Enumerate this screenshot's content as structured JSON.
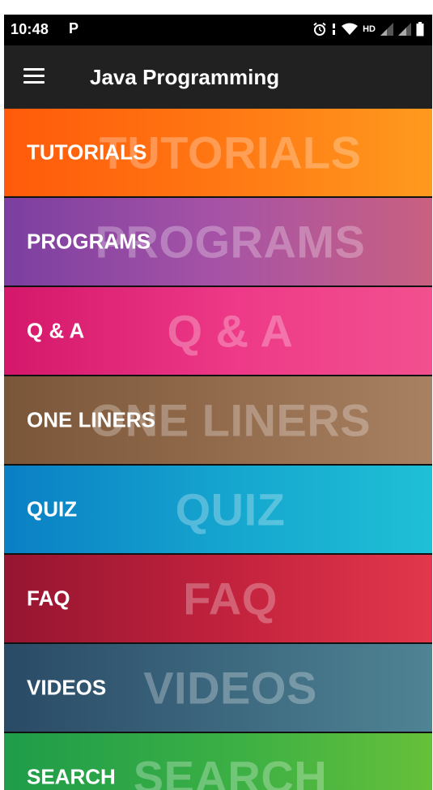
{
  "status_bar": {
    "time": "10:48",
    "notification": "P",
    "network_label": "HD"
  },
  "app_bar": {
    "title": "Java Programming",
    "menu_icon": "hamburger-menu-icon"
  },
  "menu": {
    "items": [
      {
        "label": "TUTORIALS",
        "watermark": "TUTORIALS",
        "color": "#ff7a14"
      },
      {
        "label": "PROGRAMS",
        "watermark": "PROGRAMS",
        "color": "#a653a6"
      },
      {
        "label": "Q & A",
        "watermark": "Q & A",
        "color": "#ee3a88"
      },
      {
        "label": "ONE LINERS",
        "watermark": "ONE LINERS",
        "color": "#946c4e"
      },
      {
        "label": "QUIZ",
        "watermark": "QUIZ",
        "color": "#16a7cf"
      },
      {
        "label": "FAQ",
        "watermark": "FAQ",
        "color": "#c4233e"
      },
      {
        "label": "VIDEOS",
        "watermark": "VIDEOS",
        "color": "#3e6a80"
      },
      {
        "label": "SEARCH",
        "watermark": "SEARCH",
        "color": "#3cb044"
      }
    ]
  }
}
